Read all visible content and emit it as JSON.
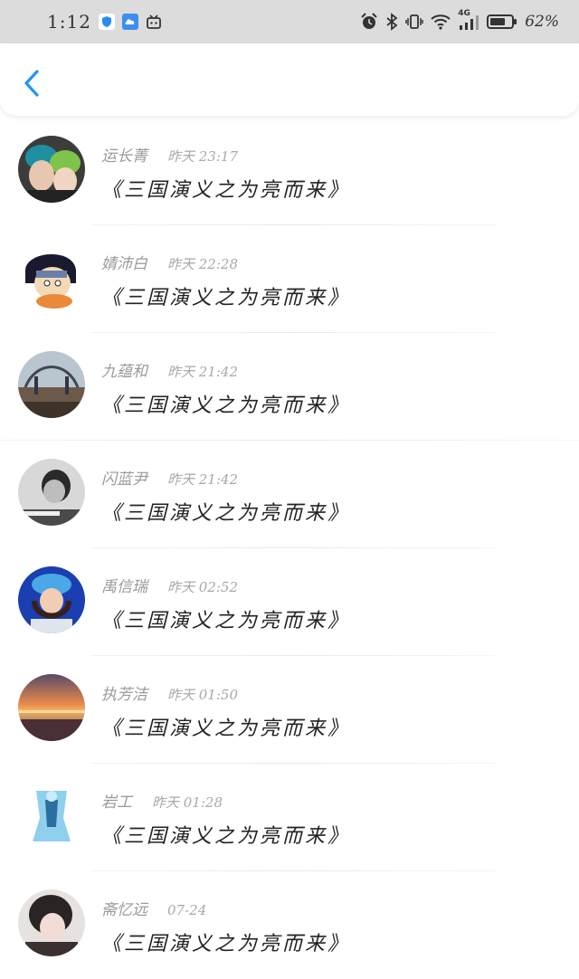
{
  "status_bar": {
    "time": "1:12",
    "network": "4G",
    "battery_percent": "62%",
    "icons": [
      "shield-icon",
      "cloud-icon",
      "bilibili-tv-icon",
      "alarm-icon",
      "bluetooth-icon",
      "vibrate-icon",
      "wifi-icon",
      "signal-icon",
      "battery-icon"
    ]
  },
  "nav": {
    "back_icon": "chevron-left-icon",
    "accent_color": "#2196f3"
  },
  "comments": [
    {
      "name": "运长菁",
      "time": "昨天 23:17",
      "text": "《三国演义之为亮而来》",
      "avatar": "couple-green-hats"
    },
    {
      "name": "婧沛白",
      "time": "昨天 22:28",
      "text": "《三国演义之为亮而来》",
      "avatar": "cartoon-ninja"
    },
    {
      "name": "九蕴和",
      "time": "昨天 21:42",
      "text": "《三国演义之为亮而来》",
      "avatar": "bridge-city"
    },
    {
      "name": "闪蓝尹",
      "time": "昨天 21:42",
      "text": "《三国演义之为亮而来》",
      "avatar": "bw-portrait"
    },
    {
      "name": "禹信瑞",
      "time": "昨天 02:52",
      "text": "《三国演义之为亮而来》",
      "avatar": "girl-blue-hat"
    },
    {
      "name": "执芳洁",
      "time": "昨天 01:50",
      "text": "《三国演义之为亮而来》",
      "avatar": "sunset-sea"
    },
    {
      "name": "岩工",
      "time": "昨天 01:28",
      "text": "《三国演义之为亮而来》",
      "avatar": "ice-sculpture"
    },
    {
      "name": "斋忆远",
      "time": "07-24",
      "text": "《三国演义之为亮而来》",
      "avatar": "girl-portrait"
    }
  ]
}
